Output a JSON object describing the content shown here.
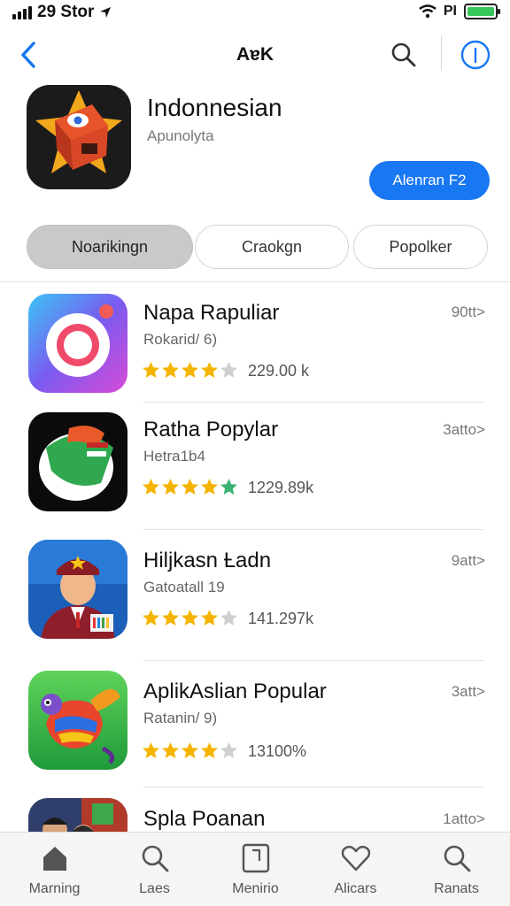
{
  "status_bar": {
    "time_carrier": "29 Stor",
    "right_text": "PI"
  },
  "nav": {
    "title": "AɐK"
  },
  "app": {
    "name": "Indonnesian",
    "subtitle": "Apunolyta",
    "get_label": "Alenran F2"
  },
  "segments": [
    {
      "label": "Noarikingn",
      "active": true
    },
    {
      "label": "Craokgn",
      "active": false
    },
    {
      "label": "Popolker",
      "active": false
    }
  ],
  "apps": [
    {
      "name": "Napa Rapuliar",
      "subtitle": "Rokarid/ 6)",
      "rating": 4,
      "count": "229.00 k",
      "size": "90tt>"
    },
    {
      "name": "Ratha Popylar",
      "subtitle": "Hetra1b4",
      "rating": 4.5,
      "count": "1229.89k",
      "size": "3atto>"
    },
    {
      "name": "Hiljkasn Ƚadn",
      "subtitle": "Gatoatall 19",
      "rating": 4,
      "count": "141.297k",
      "size": "9att>"
    },
    {
      "name": "AplikAslian Popular",
      "subtitle": "Ratanin/ 9)",
      "rating": 4,
      "count": "13100%",
      "size": "3att>"
    },
    {
      "name": "Spla Poanan",
      "subtitle": "",
      "rating": 0,
      "count": "",
      "size": "1atto>"
    }
  ],
  "tabs": [
    {
      "label": "Marning",
      "icon": "home-icon"
    },
    {
      "label": "Laes",
      "icon": "search-icon"
    },
    {
      "label": "Menirio",
      "icon": "document-icon"
    },
    {
      "label": "Alicars",
      "icon": "heart-icon"
    },
    {
      "label": "Ranats",
      "icon": "search-icon"
    }
  ],
  "colors": {
    "accent": "#1877f2",
    "star": "#f5b400",
    "star_empty": "#cfcfcf",
    "star_green": "#3bb273",
    "battery": "#34c759"
  }
}
